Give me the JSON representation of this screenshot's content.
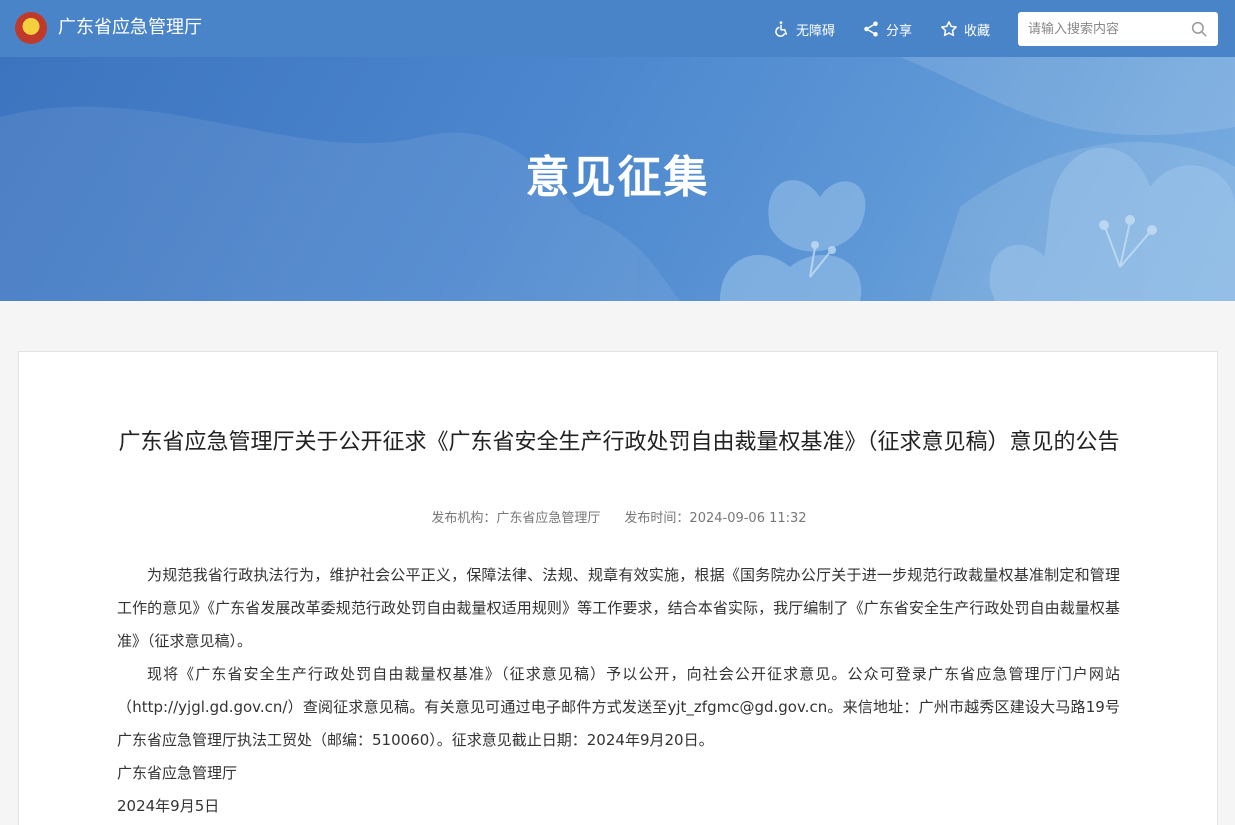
{
  "header": {
    "site_name": "广东省应急管理厅",
    "accessibility_label": "无障碍",
    "share_label": "分享",
    "favorite_label": "收藏",
    "search_placeholder": "请输入搜索内容"
  },
  "banner": {
    "title": "意见征集"
  },
  "article": {
    "title": "广东省应急管理厅关于公开征求《广东省安全生产行政处罚自由裁量权基准》（征求意见稿）意见的公告",
    "publisher": "发布机构：广东省应急管理厅",
    "publish_time": "发布时间：2024-09-06 11:32",
    "paragraphs": [
      "为规范我省行政执法行为，维护社会公平正义，保障法律、法规、规章有效实施，根据《国务院办公厅关于进一步规范行政裁量权基准制定和管理工作的意见》《广东省发展改革委规范行政处罚自由裁量权适用规则》等工作要求，结合本省实际，我厅编制了《广东省安全生产行政处罚自由裁量权基准》（征求意见稿）。",
      "现将《广东省安全生产行政处罚自由裁量权基准》（征求意见稿）予以公开，向社会公开征求意见。公众可登录广东省应急管理厅门户网站（http://yjgl.gd.gov.cn/）查阅征求意见稿。有关意见可通过电子邮件方式发送至yjt_zfgmc@gd.gov.cn。来信地址：广州市越秀区建设大马路19号广东省应急管理厅执法工贸处（邮编：510060）。征求意见截止日期：2024年9月20日。"
    ],
    "signature_org": "广东省应急管理厅",
    "signature_date": "2024年9月5日"
  },
  "colors": {
    "header_bg": "#4a84c8",
    "banner_bg": "#4a85cd",
    "page_bg": "#f5f5f5"
  }
}
